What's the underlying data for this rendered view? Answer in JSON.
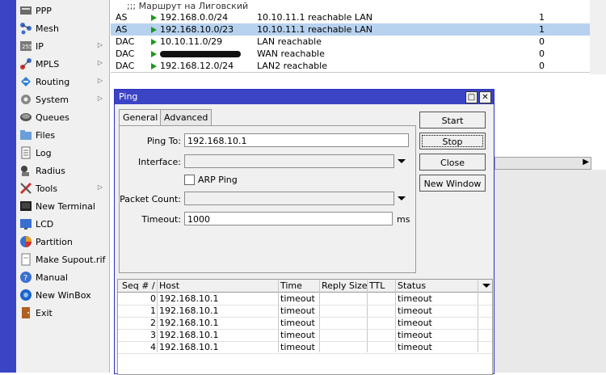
{
  "sidebar": {
    "items": [
      {
        "label": "PPP",
        "icon": "ppp-icon",
        "has_submenu": false
      },
      {
        "label": "Mesh",
        "icon": "mesh-icon",
        "has_submenu": false
      },
      {
        "label": "IP",
        "icon": "ip-icon",
        "has_submenu": true
      },
      {
        "label": "MPLS",
        "icon": "mpls-icon",
        "has_submenu": true
      },
      {
        "label": "Routing",
        "icon": "routing-icon",
        "has_submenu": true
      },
      {
        "label": "System",
        "icon": "gear-icon",
        "has_submenu": true
      },
      {
        "label": "Queues",
        "icon": "queues-icon",
        "has_submenu": false
      },
      {
        "label": "Files",
        "icon": "folder-icon",
        "has_submenu": false
      },
      {
        "label": "Log",
        "icon": "log-icon",
        "has_submenu": false
      },
      {
        "label": "Radius",
        "icon": "radius-icon",
        "has_submenu": false
      },
      {
        "label": "Tools",
        "icon": "tools-icon",
        "has_submenu": true
      },
      {
        "label": "New Terminal",
        "icon": "terminal-icon",
        "has_submenu": false
      },
      {
        "label": "LCD",
        "icon": "lcd-icon",
        "has_submenu": false
      },
      {
        "label": "Partition",
        "icon": "partition-icon",
        "has_submenu": false
      },
      {
        "label": "Make Supout.rif",
        "icon": "supout-icon",
        "has_submenu": false
      },
      {
        "label": "Manual",
        "icon": "manual-icon",
        "has_submenu": false
      },
      {
        "label": "New WinBox",
        "icon": "winbox-icon",
        "has_submenu": false
      },
      {
        "label": "Exit",
        "icon": "exit-icon",
        "has_submenu": false
      }
    ]
  },
  "routes": {
    "comment": ";;; Маршрут на Лиговский",
    "rows": [
      {
        "flags": "AS",
        "dst": "192.168.0.0/24",
        "gateway": "10.10.11.1 reachable LAN",
        "distance": "1",
        "selected": false
      },
      {
        "flags": "AS",
        "dst": "192.168.10.0/23",
        "gateway": "10.10.11.1 reachable LAN",
        "distance": "1",
        "selected": true
      },
      {
        "flags": "DAC",
        "dst": "10.10.11.0/29",
        "gateway": "LAN reachable",
        "distance": "0",
        "selected": false
      },
      {
        "flags": "DAC",
        "dst": "",
        "gateway": "WAN reachable",
        "distance": "0",
        "selected": false,
        "redacted": true
      },
      {
        "flags": "DAC",
        "dst": "192.168.12.0/24",
        "gateway": "LAN2 reachable",
        "distance": "0",
        "selected": false
      }
    ]
  },
  "ping": {
    "title": "Ping",
    "tabs": [
      "General",
      "Advanced"
    ],
    "labels": {
      "ping_to": "Ping To:",
      "interface": "Interface:",
      "arp_ping": "ARP Ping",
      "packet_count": "Packet Count:",
      "timeout": "Timeout:",
      "ms": "ms"
    },
    "values": {
      "ping_to": "192.168.10.1",
      "interface": "",
      "packet_count": "",
      "timeout": "1000"
    },
    "buttons": {
      "start": "Start",
      "stop": "Stop",
      "close": "Close",
      "new_window": "New Window"
    },
    "columns": [
      "Seq # /",
      "Host",
      "Time",
      "Reply Size",
      "TTL",
      "Status"
    ],
    "results": [
      {
        "seq": "0",
        "host": "192.168.10.1",
        "time": "timeout",
        "reply_size": "",
        "ttl": "",
        "status": "timeout"
      },
      {
        "seq": "1",
        "host": "192.168.10.1",
        "time": "timeout",
        "reply_size": "",
        "ttl": "",
        "status": "timeout"
      },
      {
        "seq": "2",
        "host": "192.168.10.1",
        "time": "timeout",
        "reply_size": "",
        "ttl": "",
        "status": "timeout"
      },
      {
        "seq": "3",
        "host": "192.168.10.1",
        "time": "timeout",
        "reply_size": "",
        "ttl": "",
        "status": "timeout"
      },
      {
        "seq": "4",
        "host": "192.168.10.1",
        "time": "timeout",
        "reply_size": "",
        "ttl": "",
        "status": "timeout"
      }
    ]
  },
  "colors": {
    "accent_blue": "#3c44c6",
    "selected_row": "#b7d2ef",
    "route_flag": "#1c9a1c"
  }
}
